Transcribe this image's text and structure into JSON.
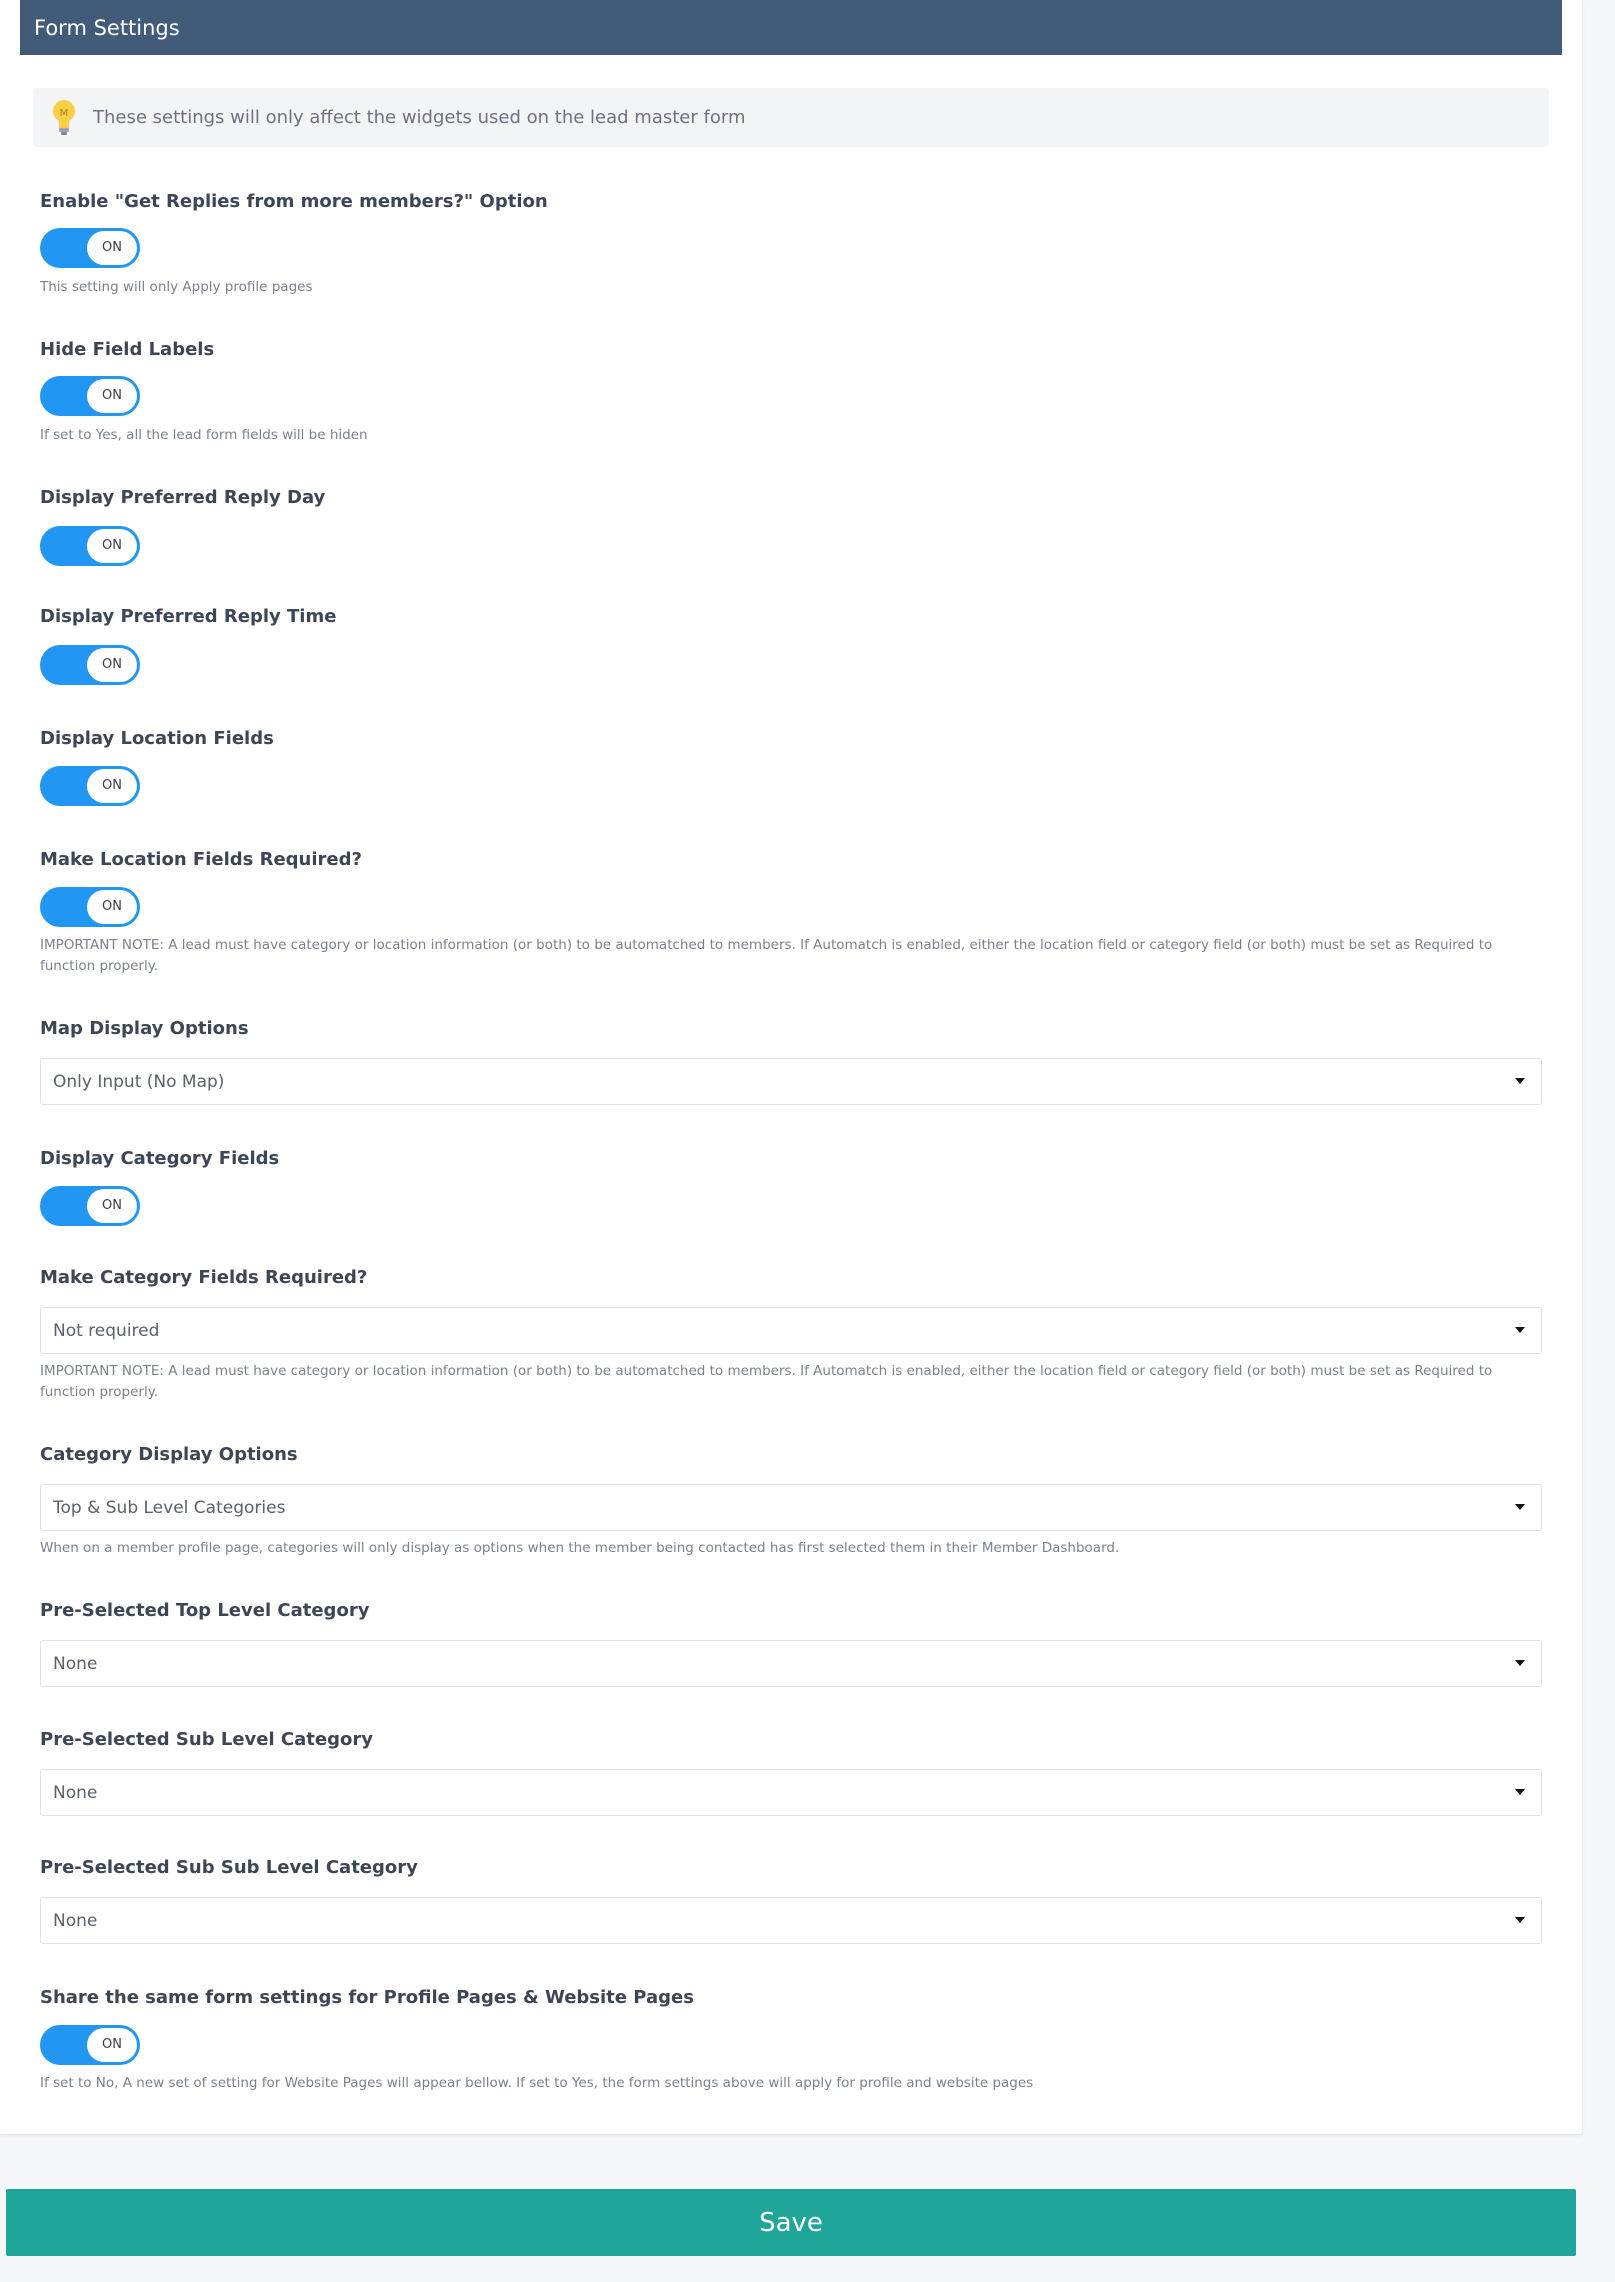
{
  "header": {
    "title": "Form Settings"
  },
  "info": {
    "icon": "lightbulb-icon",
    "text": "These settings will only affect the widgets used on the lead master form"
  },
  "settings": {
    "get_replies": {
      "label": "Enable \"Get Replies from more members?\" Option",
      "toggle": "ON",
      "help": "This setting will only Apply profile pages"
    },
    "hide_labels": {
      "label": "Hide Field Labels",
      "toggle": "ON",
      "help": "If set to Yes, all the lead form fields will be hiden"
    },
    "reply_day": {
      "label": "Display Preferred Reply Day",
      "toggle": "ON"
    },
    "reply_time": {
      "label": "Display Preferred Reply Time",
      "toggle": "ON"
    },
    "location_fields": {
      "label": "Display Location Fields",
      "toggle": "ON"
    },
    "location_required": {
      "label": "Make Location Fields Required?",
      "toggle": "ON",
      "help": "IMPORTANT NOTE: A lead must have category or location information (or both) to be automatched to members. If Automatch is enabled, either the location field or category field (or both) must be set as Required to function properly."
    },
    "map_display": {
      "label": "Map Display Options",
      "value": "Only Input (No Map)"
    },
    "category_fields": {
      "label": "Display Category Fields",
      "toggle": "ON"
    },
    "category_required": {
      "label": "Make Category Fields Required?",
      "value": "Not required",
      "help": "IMPORTANT NOTE: A lead must have category or location information (or both) to be automatched to members. If Automatch is enabled, either the location field or category field (or both) must be set as Required to function properly."
    },
    "category_display": {
      "label": "Category Display Options",
      "value": "Top & Sub Level Categories",
      "help": "When on a member profile page, categories will only display as options when the member being contacted has first selected them in their Member Dashboard."
    },
    "top_level": {
      "label": "Pre-Selected Top Level Category",
      "value": "None"
    },
    "sub_level": {
      "label": "Pre-Selected Sub Level Category",
      "value": "None"
    },
    "sub_sub_level": {
      "label": "Pre-Selected Sub Sub Level Category",
      "value": "None"
    },
    "share_settings": {
      "label": "Share the same form settings for Profile Pages & Website Pages",
      "toggle": "ON",
      "help": "If set to No, A new set of setting for Website Pages will appear bellow. If set to Yes, the form settings above will apply for profile and website pages"
    }
  },
  "save_label": "Save",
  "colors": {
    "header": "#425b78",
    "toggle": "#2196f3",
    "save": "#1fa698"
  }
}
